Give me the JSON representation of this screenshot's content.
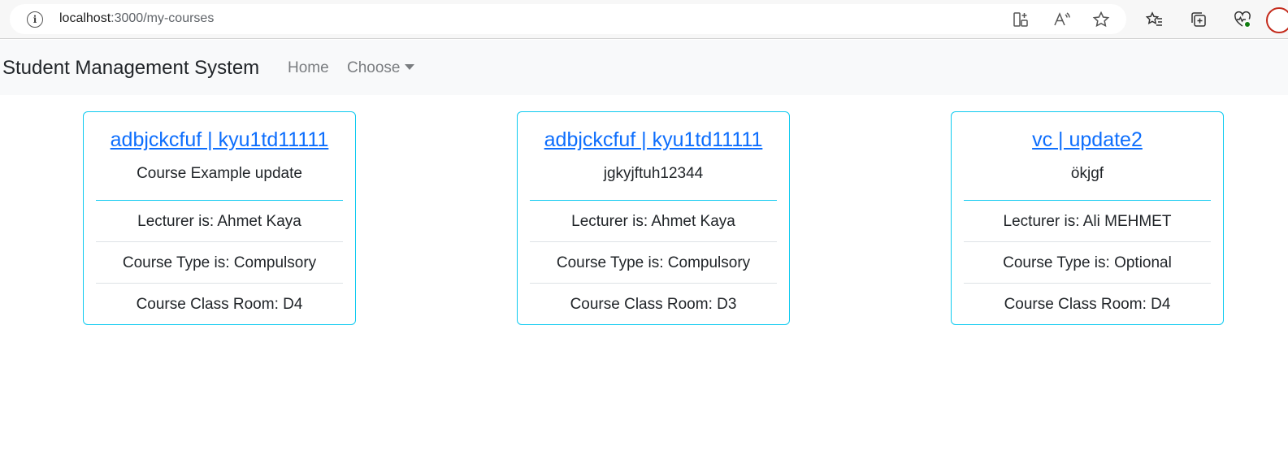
{
  "browser": {
    "url_host": "localhost",
    "url_path": ":3000/my-courses",
    "icons": [
      "info-icon",
      "grid-plus-icon",
      "read-aloud-icon",
      "star-icon",
      "favorites-icon",
      "collections-icon",
      "heart-pulse-icon"
    ]
  },
  "navbar": {
    "brand": "Student Management System",
    "home": "Home",
    "choose": "Choose"
  },
  "courses": [
    {
      "title": "adbjckcfuf | kyu1td11111",
      "description": "Course Example update",
      "lecturer": "Lecturer is: Ahmet Kaya",
      "type": "Course Type is: Compulsory",
      "room": "Course Class Room: D4"
    },
    {
      "title": "adbjckcfuf | kyu1td11111",
      "description": "jgkyjftuh12344",
      "lecturer": "Lecturer is: Ahmet Kaya",
      "type": "Course Type is: Compulsory",
      "room": "Course Class Room: D3"
    },
    {
      "title": "vc | update2",
      "description": "ökjgf",
      "lecturer": "Lecturer is: Ali MEHMET",
      "type": "Course Type is: Optional",
      "room": "Course Class Room: D4"
    }
  ],
  "colors": {
    "link": "#0d6efd",
    "card_border": "#0dcaf0",
    "navbar_bg": "#f8f9fa"
  }
}
